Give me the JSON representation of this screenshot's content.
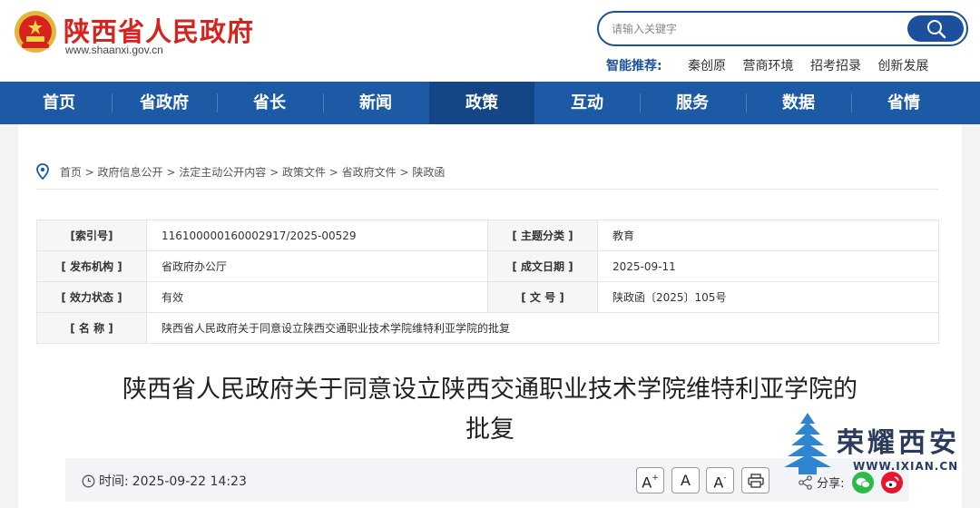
{
  "header": {
    "site_title": "陕西省人民政府",
    "site_url": "www.shaanxi.gov.cn",
    "search_placeholder": "请输入关键字",
    "recommend_label": "智能推荐:",
    "recommend_links": [
      "秦创原",
      "营商环境",
      "招考招录",
      "创新发展"
    ]
  },
  "nav": {
    "items": [
      "首页",
      "省政府",
      "省长",
      "新闻",
      "政策",
      "互动",
      "服务",
      "数据",
      "省情"
    ],
    "active": "政策"
  },
  "breadcrumb": [
    "首页",
    "政府信息公开",
    "法定主动公开内容",
    "政策文件",
    "省政府文件",
    "陕政函"
  ],
  "meta": {
    "index_label": "[索引号]",
    "index_value": "116100000160002917/2025-00529",
    "topic_label": "[ 主题分类 ]",
    "topic_value": "教育",
    "publisher_label": "[ 发布机构 ]",
    "publisher_value": "省政府办公厅",
    "date_label": "[ 成文日期 ]",
    "date_value": "2025-09-11",
    "status_label": "[ 效力状态 ]",
    "status_value": "有效",
    "docno_label": "[ 文 号 ]",
    "docno_value": "陕政函〔2025〕105号",
    "name_label": "[ 名 称 ]",
    "name_value": "陕西省人民政府关于同意设立陕西交通职业技术学院维特利亚学院的批复"
  },
  "document": {
    "title_line1": "陕西省人民政府关于同意设立陕西交通职业技术学院维特利亚学院的",
    "title_line2": "批复"
  },
  "infobar": {
    "time_label": "时间:",
    "time_value": "2025-09-22 14:23",
    "font_large": "A",
    "font_normal": "A",
    "font_small": "A",
    "share_label": "分享:"
  },
  "watermark": {
    "text": "荣耀西安",
    "url": "WWW.IXIAN.CN"
  },
  "colors": {
    "brand_red": "#d7231e",
    "nav_blue": "#1d5aa6",
    "nav_active": "#144686",
    "wechat": "#2dba48",
    "weibo": "#e6162d"
  }
}
